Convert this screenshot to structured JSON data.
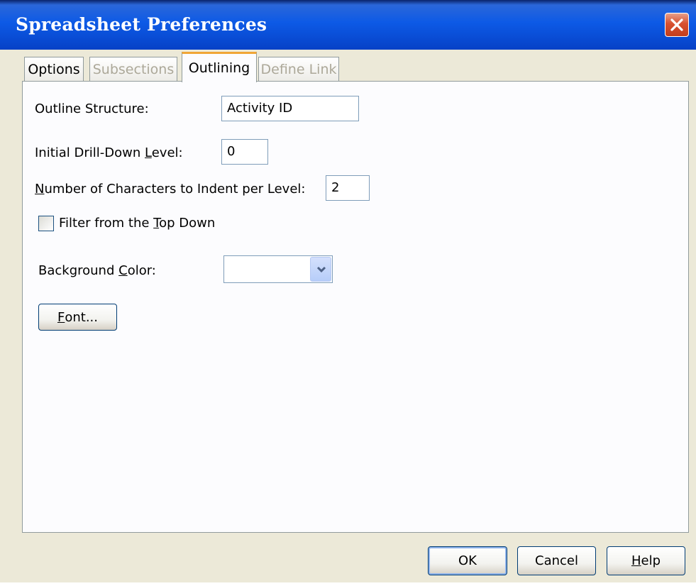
{
  "window": {
    "title": "Spreadsheet Preferences"
  },
  "tabs": [
    {
      "label": "Options",
      "state": "enabled"
    },
    {
      "label": "Subsections",
      "state": "disabled"
    },
    {
      "label": "Outlining",
      "state": "selected"
    },
    {
      "label": "Define Link",
      "state": "disabled"
    }
  ],
  "outlining": {
    "outline_structure": {
      "label": "Outline Structure:",
      "value": "Activity ID"
    },
    "drill_down": {
      "label_pre": "Initial Drill-Down ",
      "label_mnemonic": "L",
      "label_post": "evel:",
      "value": "0"
    },
    "indent": {
      "label_mnemonic": "N",
      "label_post": "umber of Characters to Indent per Level:",
      "value": "2"
    },
    "filter": {
      "label_pre": "Filter from the ",
      "label_mnemonic": "T",
      "label_post": "op Down",
      "checked": false
    },
    "background_color": {
      "label_pre": "Background ",
      "label_mnemonic": "C",
      "label_post": "olor:",
      "value": ""
    },
    "font_button": {
      "mnemonic": "F",
      "label_post": "ont..."
    }
  },
  "footer": {
    "ok": "OK",
    "cancel": "Cancel",
    "help_mnemonic": "H",
    "help_post": "elp"
  },
  "colors": {
    "titlebar": "#0a4fd8",
    "dialog_bg": "#ece9d8",
    "tab_highlight": "#f0a636",
    "close_button": "#d8502f"
  }
}
